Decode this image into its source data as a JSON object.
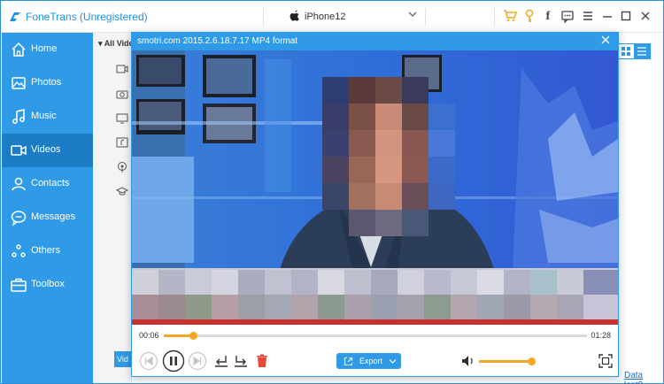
{
  "app": {
    "title": "FoneTrans (Unregistered)"
  },
  "device": {
    "name": "iPhone12",
    "icon": "apple-icon"
  },
  "toolbar_icons": [
    "cart-icon",
    "key-icon",
    "facebook-icon",
    "chat-icon",
    "menu-icon",
    "minimize-icon",
    "maximize-icon",
    "close-icon"
  ],
  "toolbar_glyphs": {
    "facebook": "f"
  },
  "sidebar": {
    "items": [
      {
        "label": "Home",
        "icon": "home-icon",
        "active": false
      },
      {
        "label": "Photos",
        "icon": "photos-icon",
        "active": false
      },
      {
        "label": "Music",
        "icon": "music-icon",
        "active": false
      },
      {
        "label": "Videos",
        "icon": "videos-icon",
        "active": true
      },
      {
        "label": "Contacts",
        "icon": "contacts-icon",
        "active": false
      },
      {
        "label": "Messages",
        "icon": "messages-icon",
        "active": false
      },
      {
        "label": "Others",
        "icon": "others-icon",
        "active": false
      },
      {
        "label": "Toolbox",
        "icon": "toolbox-icon",
        "active": false
      }
    ]
  },
  "content": {
    "filter_header": "All Vide",
    "categories": [
      "movies-icon",
      "camera-icon",
      "tv-icon",
      "music-video-icon",
      "podcast-icon",
      "itunes-u-icon"
    ],
    "bottom_button": "Vid",
    "data_lost_link": "Data lost?"
  },
  "player": {
    "title": "smotri.com 2015.2.6.18.7.17 MP4 format",
    "time_current": "00:06",
    "time_total": "01:28",
    "progress": 0.07,
    "export_label": "Export",
    "volume": 1.0
  },
  "colors": {
    "accent": "#2f9ae6",
    "accent_dark": "#1c7cc6",
    "progress": "#f5a623",
    "delete": "#e8473b"
  }
}
